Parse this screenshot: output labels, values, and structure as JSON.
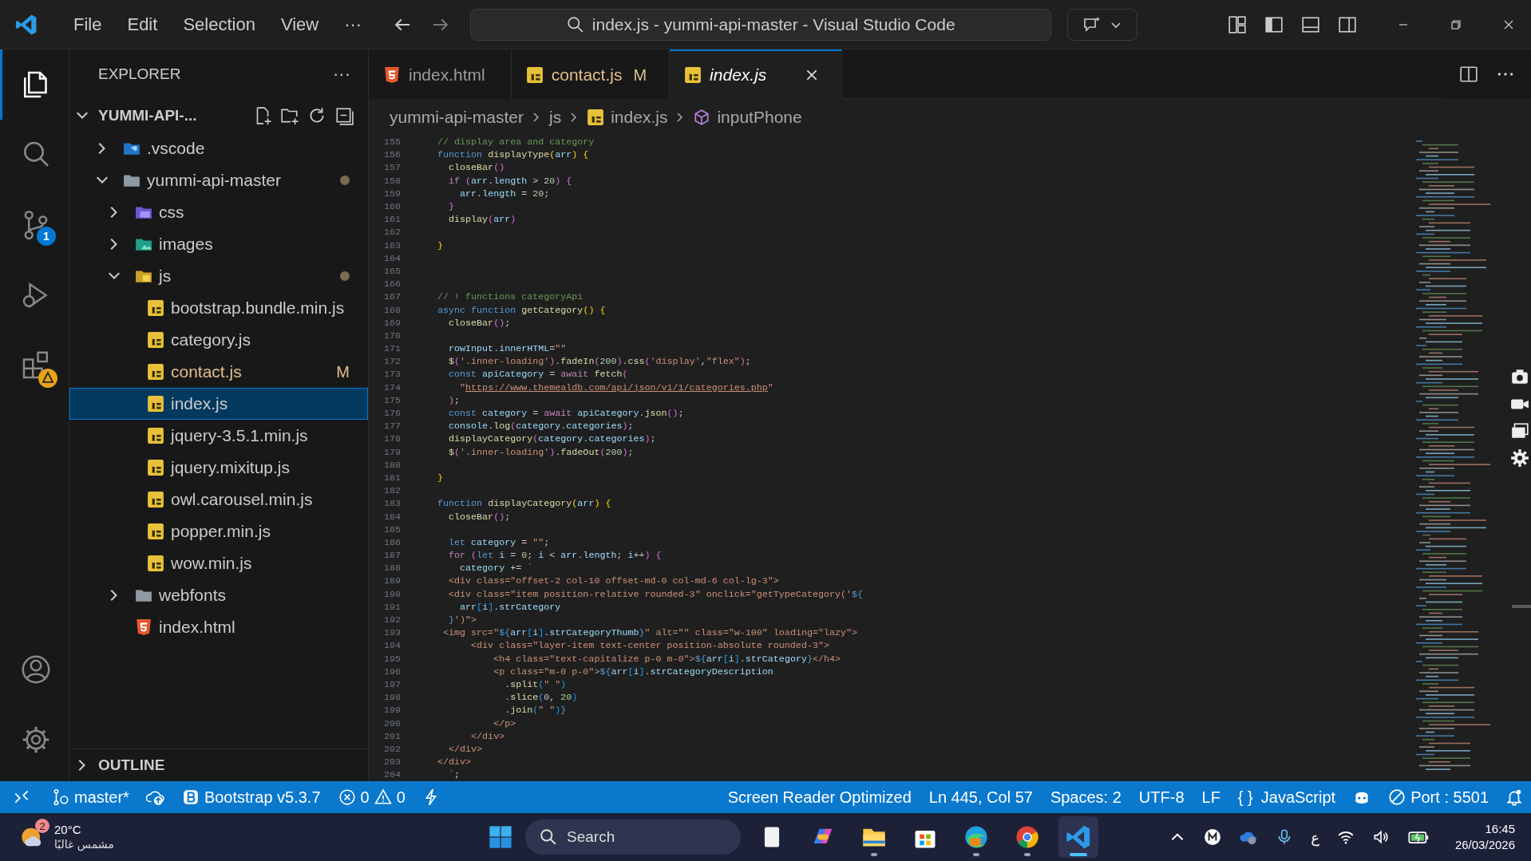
{
  "title_bar": {
    "menu": [
      {
        "label": "File"
      },
      {
        "label": "Edit"
      },
      {
        "label": "Selection"
      },
      {
        "label": "View"
      }
    ],
    "more": "···",
    "command_center": "index.js - yummi-api-master - Visual Studio Code"
  },
  "activity_bar": [
    {
      "kind": "explorer",
      "selected": true
    },
    {
      "kind": "search",
      "selected": false
    },
    {
      "kind": "scm",
      "selected": false,
      "badge": "1"
    },
    {
      "kind": "debug",
      "selected": false
    },
    {
      "kind": "extensions",
      "selected": false,
      "warning": true
    },
    {
      "kind": "account",
      "selected": false
    },
    {
      "kind": "settings",
      "selected": false
    }
  ],
  "sidebar": {
    "title": "EXPLORER",
    "more": "···",
    "root": "YUMMI-API-...",
    "outline": "OUTLINE",
    "tree": [
      {
        "label": ".vscode",
        "kind": "vscode-folder",
        "expanded": false,
        "selected": false,
        "modified": false
      },
      {
        "label": "yummi-api-master",
        "kind": "folder",
        "expanded": true,
        "selected": false,
        "modified": true,
        "children": [
          {
            "label": "css",
            "kind": "css-folder",
            "expanded": false,
            "selected": false,
            "modified": false
          },
          {
            "label": "images",
            "kind": "image-folder",
            "expanded": false,
            "selected": false,
            "modified": false
          },
          {
            "label": "js",
            "kind": "js-folder",
            "expanded": true,
            "selected": false,
            "modified": true,
            "children": [
              {
                "label": "bootstrap.bundle.min.js",
                "kind": "js-file",
                "selected": false,
                "modified": false
              },
              {
                "label": "category.js",
                "kind": "js-file",
                "selected": false,
                "modified": false
              },
              {
                "label": "contact.js",
                "kind": "js-file",
                "selected": false,
                "modified": true,
                "status": "M"
              },
              {
                "label": "index.js",
                "kind": "js-file",
                "selected": true,
                "modified": false
              },
              {
                "label": "jquery-3.5.1.min.js",
                "kind": "js-file",
                "selected": false,
                "modified": false
              },
              {
                "label": "jquery.mixitup.js",
                "kind": "js-file",
                "selected": false,
                "modified": false
              },
              {
                "label": "owl.carousel.min.js",
                "kind": "js-file",
                "selected": false,
                "modified": false
              },
              {
                "label": "popper.min.js",
                "kind": "js-file",
                "selected": false,
                "modified": false
              },
              {
                "label": "wow.min.js",
                "kind": "js-file",
                "selected": false,
                "modified": false
              }
            ]
          },
          {
            "label": "webfonts",
            "kind": "folder",
            "expanded": false,
            "selected": false,
            "modified": false
          },
          {
            "label": "index.html",
            "kind": "html-file",
            "selected": false,
            "modified": false
          }
        ]
      }
    ]
  },
  "tabs": [
    {
      "label": "index.html",
      "kind": "html-file",
      "selected": false,
      "modified": false,
      "preview": false
    },
    {
      "label": "contact.js",
      "kind": "js-file",
      "selected": false,
      "modified": true,
      "status": "M",
      "preview": false
    },
    {
      "label": "index.js",
      "kind": "js-file",
      "selected": true,
      "modified": false,
      "preview": true
    }
  ],
  "breadcrumb": [
    {
      "label": "yummi-api-master",
      "kind": "folder"
    },
    {
      "label": "js",
      "kind": "folder"
    },
    {
      "label": "index.js",
      "kind": "js-file"
    },
    {
      "label": "inputPhone",
      "kind": "symbol"
    }
  ],
  "editor": {
    "lines": [
      {
        "number": "155",
        "tokens": [
          {
            "kind": "com",
            "text": "// display area and category"
          }
        ]
      },
      {
        "number": "156",
        "tokens": [
          {
            "kind": "kw",
            "text": "function "
          },
          {
            "kind": "fn",
            "text": "displayType"
          },
          {
            "kind": "b1",
            "text": "("
          },
          {
            "kind": "var",
            "text": "arr"
          },
          {
            "kind": "b1",
            "text": ")"
          },
          {
            "kind": "b1",
            "text": " {"
          }
        ]
      },
      {
        "number": "157",
        "tokens": [
          {
            "kind": "fn",
            "text": "  closeBar"
          },
          {
            "kind": "b2",
            "text": "()"
          }
        ]
      },
      {
        "number": "158",
        "tokens": [
          {
            "kind": "ctrl",
            "text": "  if"
          },
          {
            "kind": "b2",
            "text": " ("
          },
          {
            "kind": "var",
            "text": "arr"
          },
          {
            "kind": "pl",
            "text": "."
          },
          {
            "kind": "var",
            "text": "length"
          },
          {
            "kind": "pl",
            "text": " > "
          },
          {
            "kind": "num",
            "text": "20"
          },
          {
            "kind": "b2",
            "text": ")"
          },
          {
            "kind": "b2",
            "text": " {"
          }
        ]
      },
      {
        "number": "159",
        "tokens": [
          {
            "kind": "var",
            "text": "    arr"
          },
          {
            "kind": "pl",
            "text": "."
          },
          {
            "kind": "var",
            "text": "length"
          },
          {
            "kind": "pl",
            "text": " = "
          },
          {
            "kind": "num",
            "text": "20"
          },
          {
            "kind": "pl",
            "text": ";"
          }
        ]
      },
      {
        "number": "160",
        "tokens": [
          {
            "kind": "b2",
            "text": "  }"
          }
        ]
      },
      {
        "number": "161",
        "tokens": [
          {
            "kind": "fn",
            "text": "  display"
          },
          {
            "kind": "b2",
            "text": "("
          },
          {
            "kind": "var",
            "text": "arr"
          },
          {
            "kind": "b2",
            "text": ")"
          }
        ]
      },
      {
        "number": "162"
      },
      {
        "number": "163",
        "tokens": [
          {
            "kind": "b1",
            "text": "}"
          }
        ]
      },
      {
        "number": "164"
      },
      {
        "number": "165"
      },
      {
        "number": "166"
      },
      {
        "number": "167",
        "tokens": [
          {
            "kind": "com",
            "text": "// ! functions categoryApi"
          }
        ]
      },
      {
        "number": "168",
        "tokens": [
          {
            "kind": "kw",
            "text": "async "
          },
          {
            "kind": "kw",
            "text": "function "
          },
          {
            "kind": "fn",
            "text": "getCategory"
          },
          {
            "kind": "b1",
            "text": "()"
          },
          {
            "kind": "b1",
            "text": " {"
          }
        ]
      },
      {
        "number": "169",
        "tokens": [
          {
            "kind": "fn",
            "text": "  closeBar"
          },
          {
            "kind": "b2",
            "text": "()"
          },
          {
            "kind": "pl",
            "text": ";"
          }
        ]
      },
      {
        "number": "170"
      },
      {
        "number": "171",
        "tokens": [
          {
            "kind": "var",
            "text": "  rowInput"
          },
          {
            "kind": "pl",
            "text": "."
          },
          {
            "kind": "var",
            "text": "innerHTML"
          },
          {
            "kind": "pl",
            "text": "="
          },
          {
            "kind": "str",
            "text": "\"\""
          }
        ]
      },
      {
        "number": "172",
        "tokens": [
          {
            "kind": "fn",
            "text": "  $"
          },
          {
            "kind": "b2",
            "text": "("
          },
          {
            "kind": "str",
            "text": "'.inner-loading'"
          },
          {
            "kind": "b2",
            "text": ")"
          },
          {
            "kind": "pl",
            "text": "."
          },
          {
            "kind": "fn",
            "text": "fadeIn"
          },
          {
            "kind": "b2",
            "text": "("
          },
          {
            "kind": "num",
            "text": "200"
          },
          {
            "kind": "b2",
            "text": ")"
          },
          {
            "kind": "pl",
            "text": "."
          },
          {
            "kind": "fn",
            "text": "css"
          },
          {
            "kind": "b2",
            "text": "("
          },
          {
            "kind": "str",
            "text": "'display'"
          },
          {
            "kind": "pl",
            "text": ","
          },
          {
            "kind": "str",
            "text": "\"flex\""
          },
          {
            "kind": "b2",
            "text": ")"
          },
          {
            "kind": "pl",
            "text": ";"
          }
        ]
      },
      {
        "number": "173",
        "tokens": [
          {
            "kind": "kw",
            "text": "  const "
          },
          {
            "kind": "var",
            "text": "apiCategory"
          },
          {
            "kind": "pl",
            "text": " = "
          },
          {
            "kind": "ctrl",
            "text": "await "
          },
          {
            "kind": "fn",
            "text": "fetch"
          },
          {
            "kind": "b2",
            "text": "("
          }
        ]
      },
      {
        "number": "174",
        "tokens": [
          {
            "kind": "str",
            "text": "    \""
          },
          {
            "kind": "url",
            "text": "https://www.themealdb.com/api/json/v1/1/categories.php"
          },
          {
            "kind": "str",
            "text": "\""
          }
        ]
      },
      {
        "number": "175",
        "tokens": [
          {
            "kind": "b2",
            "text": "  )"
          },
          {
            "kind": "pl",
            "text": ";"
          }
        ]
      },
      {
        "number": "176",
        "tokens": [
          {
            "kind": "kw",
            "text": "  const "
          },
          {
            "kind": "var",
            "text": "category"
          },
          {
            "kind": "pl",
            "text": " = "
          },
          {
            "kind": "ctrl",
            "text": "await "
          },
          {
            "kind": "var",
            "text": "apiCategory"
          },
          {
            "kind": "pl",
            "text": "."
          },
          {
            "kind": "fn",
            "text": "json"
          },
          {
            "kind": "b2",
            "text": "()"
          },
          {
            "kind": "pl",
            "text": ";"
          }
        ]
      },
      {
        "number": "177",
        "tokens": [
          {
            "kind": "var",
            "text": "  console"
          },
          {
            "kind": "pl",
            "text": "."
          },
          {
            "kind": "fn",
            "text": "log"
          },
          {
            "kind": "b2",
            "text": "("
          },
          {
            "kind": "var",
            "text": "category"
          },
          {
            "kind": "pl",
            "text": "."
          },
          {
            "kind": "var",
            "text": "categories"
          },
          {
            "kind": "b2",
            "text": ")"
          },
          {
            "kind": "pl",
            "text": ";"
          }
        ]
      },
      {
        "number": "178",
        "tokens": [
          {
            "kind": "fn",
            "text": "  displayCategory"
          },
          {
            "kind": "b2",
            "text": "("
          },
          {
            "kind": "var",
            "text": "category"
          },
          {
            "kind": "pl",
            "text": "."
          },
          {
            "kind": "var",
            "text": "categories"
          },
          {
            "kind": "b2",
            "text": ")"
          },
          {
            "kind": "pl",
            "text": ";"
          }
        ]
      },
      {
        "number": "179",
        "tokens": [
          {
            "kind": "fn",
            "text": "  $"
          },
          {
            "kind": "b2",
            "text": "("
          },
          {
            "kind": "str",
            "text": "'.inner-loading'"
          },
          {
            "kind": "b2",
            "text": ")"
          },
          {
            "kind": "pl",
            "text": "."
          },
          {
            "kind": "fn",
            "text": "fadeOut"
          },
          {
            "kind": "b2",
            "text": "("
          },
          {
            "kind": "num",
            "text": "200"
          },
          {
            "kind": "b2",
            "text": ")"
          },
          {
            "kind": "pl",
            "text": ";"
          }
        ]
      },
      {
        "number": "180"
      },
      {
        "number": "181",
        "tokens": [
          {
            "kind": "b1",
            "text": "}"
          }
        ]
      },
      {
        "number": "182"
      },
      {
        "number": "183",
        "tokens": [
          {
            "kind": "kw",
            "text": "function "
          },
          {
            "kind": "fn",
            "text": "displayCategory"
          },
          {
            "kind": "b1",
            "text": "("
          },
          {
            "kind": "var",
            "text": "arr"
          },
          {
            "kind": "b1",
            "text": ")"
          },
          {
            "kind": "b1",
            "text": " {"
          }
        ]
      },
      {
        "number": "184",
        "tokens": [
          {
            "kind": "fn",
            "text": "  closeBar"
          },
          {
            "kind": "b2",
            "text": "()"
          },
          {
            "kind": "pl",
            "text": ";"
          }
        ]
      },
      {
        "number": "185"
      },
      {
        "number": "186",
        "tokens": [
          {
            "kind": "kw",
            "text": "  let "
          },
          {
            "kind": "var",
            "text": "category"
          },
          {
            "kind": "pl",
            "text": " = "
          },
          {
            "kind": "str",
            "text": "\"\""
          },
          {
            "kind": "pl",
            "text": ";"
          }
        ]
      },
      {
        "number": "187",
        "tokens": [
          {
            "kind": "ctrl",
            "text": "  for "
          },
          {
            "kind": "b2",
            "text": "("
          },
          {
            "kind": "kw",
            "text": "let "
          },
          {
            "kind": "var",
            "text": "i"
          },
          {
            "kind": "pl",
            "text": " = "
          },
          {
            "kind": "num",
            "text": "0"
          },
          {
            "kind": "pl",
            "text": "; "
          },
          {
            "kind": "var",
            "text": "i"
          },
          {
            "kind": "pl",
            "text": " < "
          },
          {
            "kind": "var",
            "text": "arr"
          },
          {
            "kind": "pl",
            "text": "."
          },
          {
            "kind": "var",
            "text": "length"
          },
          {
            "kind": "pl",
            "text": "; "
          },
          {
            "kind": "var",
            "text": "i"
          },
          {
            "kind": "pl",
            "text": "++"
          },
          {
            "kind": "b2",
            "text": ")"
          },
          {
            "kind": "b2",
            "text": " {"
          }
        ]
      },
      {
        "number": "188",
        "tokens": [
          {
            "kind": "var",
            "text": "    category"
          },
          {
            "kind": "pl",
            "text": " += "
          },
          {
            "kind": "str",
            "text": "`"
          }
        ]
      },
      {
        "number": "189",
        "tokens": [
          {
            "kind": "str",
            "text": "  <div class=\"offset-2 col-10 offset-md-0 col-md-6 col-lg-3\">"
          }
        ]
      },
      {
        "number": "190",
        "tokens": [
          {
            "kind": "str",
            "text": "  <div class=\"item position-relative rounded-3\" onclick=\"getTypeCategory('"
          },
          {
            "kind": "kw",
            "text": "${"
          }
        ]
      },
      {
        "number": "191",
        "tokens": [
          {
            "kind": "var",
            "text": "    arr"
          },
          {
            "kind": "b3",
            "text": "["
          },
          {
            "kind": "var",
            "text": "i"
          },
          {
            "kind": "b3",
            "text": "]"
          },
          {
            "kind": "pl",
            "text": "."
          },
          {
            "kind": "var",
            "text": "strCategory"
          }
        ]
      },
      {
        "number": "192",
        "tokens": [
          {
            "kind": "kw",
            "text": "  }"
          },
          {
            "kind": "str",
            "text": "')\">"
          }
        ]
      },
      {
        "number": "193",
        "tokens": [
          {
            "kind": "str",
            "text": " <img src=\""
          },
          {
            "kind": "kw",
            "text": "${"
          },
          {
            "kind": "var",
            "text": "arr"
          },
          {
            "kind": "b3",
            "text": "["
          },
          {
            "kind": "var",
            "text": "i"
          },
          {
            "kind": "b3",
            "text": "]"
          },
          {
            "kind": "pl",
            "text": "."
          },
          {
            "kind": "var",
            "text": "strCategoryThumb"
          },
          {
            "kind": "kw",
            "text": "}"
          },
          {
            "kind": "str",
            "text": "\" alt=\"\" class=\"w-100\" loading=\"lazy\">"
          }
        ]
      },
      {
        "number": "194",
        "tokens": [
          {
            "kind": "str",
            "text": "      <div class=\"layer-item text-center position-absolute rounded-3\">"
          }
        ]
      },
      {
        "number": "195",
        "tokens": [
          {
            "kind": "str",
            "text": "          <h4 class=\"text-capitalize p-0 m-0\">"
          },
          {
            "kind": "kw",
            "text": "${"
          },
          {
            "kind": "var",
            "text": "arr"
          },
          {
            "kind": "b3",
            "text": "["
          },
          {
            "kind": "var",
            "text": "i"
          },
          {
            "kind": "b3",
            "text": "]"
          },
          {
            "kind": "pl",
            "text": "."
          },
          {
            "kind": "var",
            "text": "strCategory"
          },
          {
            "kind": "kw",
            "text": "}"
          },
          {
            "kind": "str",
            "text": "</h4>"
          }
        ]
      },
      {
        "number": "196",
        "tokens": [
          {
            "kind": "str",
            "text": "          <p class=\"m-0 p-0\">"
          },
          {
            "kind": "kw",
            "text": "${"
          },
          {
            "kind": "var",
            "text": "arr"
          },
          {
            "kind": "b3",
            "text": "["
          },
          {
            "kind": "var",
            "text": "i"
          },
          {
            "kind": "b3",
            "text": "]"
          },
          {
            "kind": "pl",
            "text": "."
          },
          {
            "kind": "var",
            "text": "strCategoryDescription"
          }
        ]
      },
      {
        "number": "197",
        "tokens": [
          {
            "kind": "pl",
            "text": "            ."
          },
          {
            "kind": "fn",
            "text": "split"
          },
          {
            "kind": "b3",
            "text": "("
          },
          {
            "kind": "str",
            "text": "\" \""
          },
          {
            "kind": "b3",
            "text": ")"
          }
        ]
      },
      {
        "number": "198",
        "tokens": [
          {
            "kind": "pl",
            "text": "            ."
          },
          {
            "kind": "fn",
            "text": "slice"
          },
          {
            "kind": "b3",
            "text": "("
          },
          {
            "kind": "num",
            "text": "0"
          },
          {
            "kind": "pl",
            "text": ", "
          },
          {
            "kind": "num",
            "text": "20"
          },
          {
            "kind": "b3",
            "text": ")"
          }
        ]
      },
      {
        "number": "199",
        "tokens": [
          {
            "kind": "pl",
            "text": "            ."
          },
          {
            "kind": "fn",
            "text": "join"
          },
          {
            "kind": "b3",
            "text": "("
          },
          {
            "kind": "str",
            "text": "\" \""
          },
          {
            "kind": "b3",
            "text": ")"
          },
          {
            "kind": "kw",
            "text": "}"
          }
        ]
      },
      {
        "number": "200",
        "tokens": [
          {
            "kind": "str",
            "text": "          </p>"
          }
        ]
      },
      {
        "number": "201",
        "tokens": [
          {
            "kind": "str",
            "text": "      </div>"
          }
        ]
      },
      {
        "number": "202",
        "tokens": [
          {
            "kind": "str",
            "text": "  </div>"
          }
        ]
      },
      {
        "number": "203",
        "tokens": [
          {
            "kind": "str",
            "text": "</div>"
          }
        ]
      },
      {
        "number": "204",
        "tokens": [
          {
            "kind": "str",
            "text": "  `"
          },
          {
            "kind": "pl",
            "text": ";"
          }
        ]
      }
    ]
  },
  "status_bar": {
    "left": [
      {
        "kind": "remote"
      },
      {
        "kind": "branch",
        "text": "master*"
      },
      {
        "kind": "sync"
      },
      {
        "kind": "bootstrap",
        "text": "Bootstrap v5.3.7"
      },
      {
        "kind": "problems",
        "errors": "0",
        "warnings": "0"
      },
      {
        "kind": "lightning"
      }
    ],
    "right": [
      {
        "kind": "text",
        "text": "Screen Reader Optimized"
      },
      {
        "kind": "text",
        "text": "Ln 445, Col 57"
      },
      {
        "kind": "text",
        "text": "Spaces: 2"
      },
      {
        "kind": "text",
        "text": "UTF-8"
      },
      {
        "kind": "text",
        "text": "LF"
      },
      {
        "kind": "language",
        "icon_text": "{ }",
        "text": "JavaScript"
      },
      {
        "kind": "copilot"
      },
      {
        "kind": "port",
        "text": "Port : 5501"
      },
      {
        "kind": "bell"
      }
    ]
  },
  "taskbar": {
    "weather": {
      "badge": "2",
      "temp": "20°C",
      "condition": "مشمس غالبًا"
    },
    "search": {
      "placeholder": "Search"
    },
    "apps": [
      {
        "kind": "document",
        "selected": false,
        "running": false
      },
      {
        "kind": "copilot",
        "selected": false,
        "running": false
      },
      {
        "kind": "folder",
        "selected": false,
        "running": true
      },
      {
        "kind": "store",
        "selected": false,
        "running": false
      },
      {
        "kind": "edge",
        "selected": false,
        "running": true
      },
      {
        "kind": "chrome",
        "selected": false,
        "running": true
      },
      {
        "kind": "vscode",
        "selected": true,
        "running": true
      }
    ],
    "tray": [
      {
        "kind": "chevron"
      },
      {
        "kind": "m"
      },
      {
        "kind": "cloud"
      },
      {
        "kind": "mic"
      },
      {
        "kind": "lang",
        "text": "ع"
      },
      {
        "kind": "wifi"
      },
      {
        "kind": "volume"
      },
      {
        "kind": "battery"
      }
    ],
    "clock": {
      "time": "16:45",
      "date": "26/03/2026"
    }
  }
}
